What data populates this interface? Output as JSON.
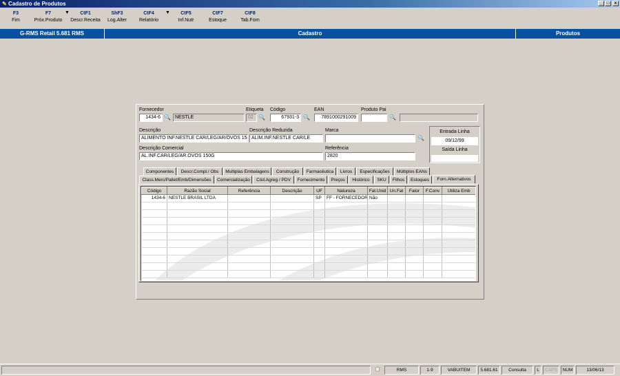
{
  "window": {
    "title": "Cadastro de Produtos"
  },
  "toolbar": [
    {
      "key": "F3",
      "label": "Fim"
    },
    {
      "key": "F7",
      "label": "Próx.Produto"
    },
    {
      "key": "CtF1",
      "label": "Descr.Receita"
    },
    {
      "key": "ShF3",
      "label": "Log.Alter"
    },
    {
      "key": "CtF4",
      "label": "Relatório"
    },
    {
      "key": "CtF5",
      "label": "Inf.Nutr"
    },
    {
      "key": "CtF7",
      "label": "Estoque"
    },
    {
      "key": "CtF8",
      "label": "Tab.Forn"
    }
  ],
  "header": {
    "app": "G-RMS Retail 5.681 RMS",
    "section": "Cadastro",
    "module": "Produtos"
  },
  "form": {
    "fornecedor_label": "Fornecedor",
    "fornecedor_code": "1434-6",
    "fornecedor_name": "NESTLE",
    "etiqueta_label": "Etiqueta",
    "etiqueta_value": "02",
    "codigo_label": "Código",
    "codigo_value": "67931-3",
    "ean_label": "EAN",
    "ean_value": "7891000291009",
    "produto_pai_label": "Produto Pai",
    "produto_pai_value": "",
    "descricao_label": "Descrição",
    "descricao_value": "ALIMENTO INF.NESTLE CAR/LEG/AR/OVOS 150G",
    "descr_reduzida_label": "Descrição Reduzida",
    "descr_reduzida_value": "ALIM.INF.NESTLE CAR/LE",
    "marca_label": "Marca",
    "marca_value": "",
    "descr_comercial_label": "Descrição Comercial",
    "descr_comercial_value": "AL.INF.CAR/LEG/AR.OVOS 150G",
    "referencia_label": "Referência",
    "referencia_value": "2820",
    "entrada_linha_label": "Entrada Linha",
    "entrada_linha_value": "09/12/99",
    "saida_linha_label": "Saída Linha",
    "saida_linha_value": ""
  },
  "tabs_row1": [
    "Componentes",
    "Descr.Compl./ Obs",
    "Multiplas Embalagens",
    "Construção",
    "Farmacêutica",
    "Livros",
    "Especificações",
    "Múltiplos EANs"
  ],
  "tabs_row2": [
    "Class.Merc/Pallet/Emb/Dimensões",
    "Comercialização",
    "Cód.Agreg / PDV",
    "Fornecimento",
    "Preços",
    "Histórico",
    "SKU",
    "Filhos",
    "Estoques",
    "Forn.Alternativos"
  ],
  "grid": {
    "columns": [
      "Código",
      "Razão Social",
      "Referência",
      "Descrição",
      "UF",
      "Natureza",
      "Fat.Unid",
      "Un.Fat",
      "Fator",
      "F.Conv",
      "Utiliza Emb"
    ],
    "rows": [
      [
        "1434-6",
        "NESTLE BRASIL LTDA",
        "",
        "",
        "SP",
        "FF - FORNECEDOR",
        "Não",
        "",
        "",
        "",
        ""
      ]
    ]
  },
  "statusbar": {
    "system": "RMS",
    "page": "1-9",
    "user": "VABUITEM",
    "version": "5.681.61",
    "mode": "Consulta",
    "l": "L",
    "caps": "CAPS",
    "num": "NUM",
    "date": "13/06/13"
  }
}
